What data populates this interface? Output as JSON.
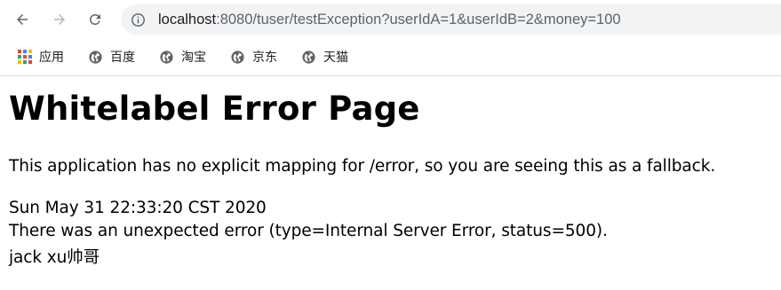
{
  "browser": {
    "url_host": "localhost",
    "url_rest": ":8080/tuser/testException?userIdA=1&userIdB=2&money=100",
    "bookmarks": [
      {
        "label": "应用",
        "icon": "apps-grid-icon"
      },
      {
        "label": "百度",
        "icon": "globe-icon"
      },
      {
        "label": "淘宝",
        "icon": "globe-icon"
      },
      {
        "label": "京东",
        "icon": "globe-icon"
      },
      {
        "label": "天猫",
        "icon": "globe-icon"
      }
    ]
  },
  "page": {
    "title": "Whitelabel Error Page",
    "description": "This application has no explicit mapping for /error, so you are seeing this as a fallback.",
    "timestamp": "Sun May 31 22:33:20 CST 2020",
    "error": "There was an unexpected error (type=Internal Server Error, status=500).",
    "message": "jack xu帅哥"
  }
}
